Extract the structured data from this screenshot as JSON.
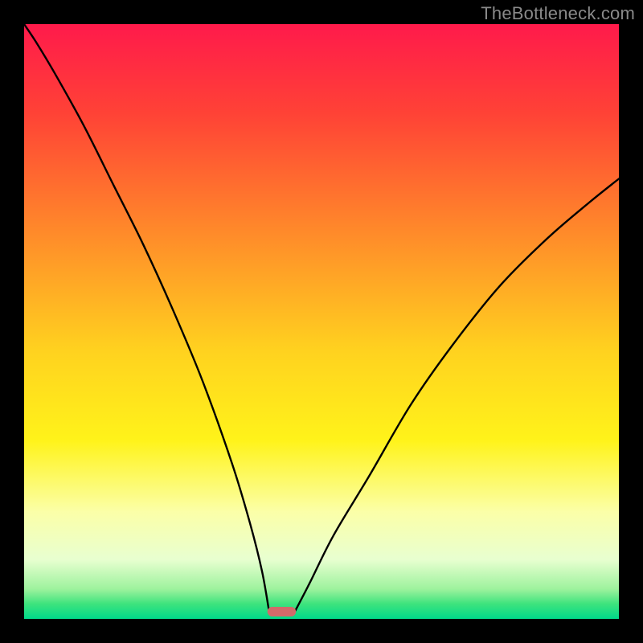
{
  "watermark": "TheBottleneck.com",
  "chart_data": {
    "type": "line",
    "title": "",
    "xlabel": "",
    "ylabel": "",
    "xlim": [
      0,
      100
    ],
    "ylim": [
      0,
      100
    ],
    "gradient_stops": [
      {
        "offset": 0.0,
        "color": "#ff1a4b"
      },
      {
        "offset": 0.15,
        "color": "#ff4236"
      },
      {
        "offset": 0.35,
        "color": "#ff8a2a"
      },
      {
        "offset": 0.55,
        "color": "#ffd21f"
      },
      {
        "offset": 0.7,
        "color": "#fff31a"
      },
      {
        "offset": 0.82,
        "color": "#fbffa8"
      },
      {
        "offset": 0.9,
        "color": "#e8ffd0"
      },
      {
        "offset": 0.95,
        "color": "#9df29d"
      },
      {
        "offset": 0.975,
        "color": "#3de37d"
      },
      {
        "offset": 1.0,
        "color": "#00d98a"
      }
    ],
    "series": [
      {
        "name": "bottleneck-curve-left",
        "x": [
          0,
          2,
          5,
          10,
          15,
          20,
          25,
          30,
          35,
          38,
          40,
          41.2
        ],
        "y": [
          100,
          97,
          92,
          83,
          73,
          63,
          52,
          40,
          26,
          16,
          8,
          1.2
        ]
      },
      {
        "name": "bottleneck-curve-right",
        "x": [
          45.5,
          48,
          52,
          58,
          65,
          72,
          80,
          88,
          95,
          100
        ],
        "y": [
          1.2,
          6,
          14,
          24,
          36,
          46,
          56,
          64,
          70,
          74
        ]
      }
    ],
    "marker": {
      "name": "optimal-range",
      "x_center": 43.3,
      "width": 4.8,
      "color": "#d26a6a"
    }
  }
}
